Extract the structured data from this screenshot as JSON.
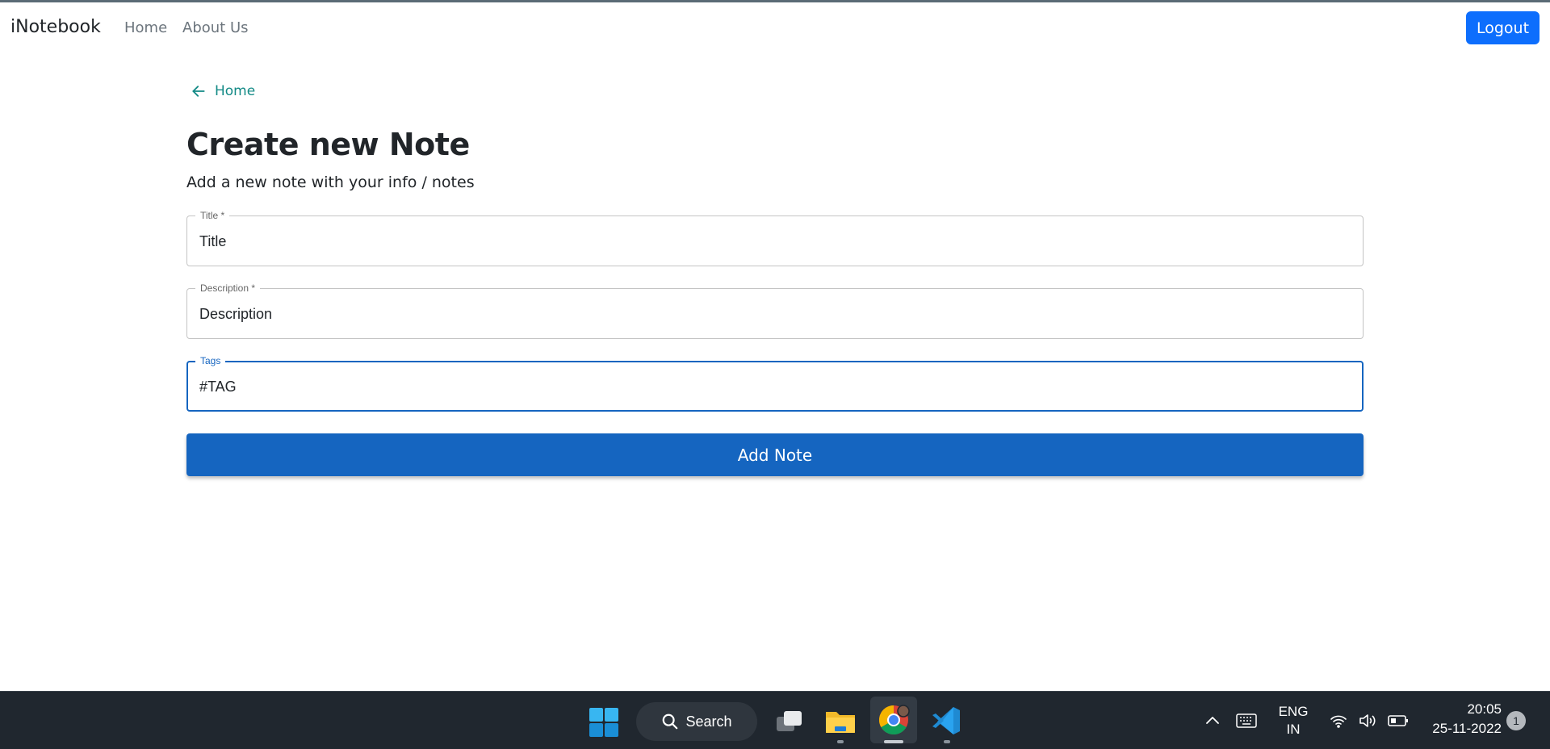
{
  "navbar": {
    "brand": "iNotebook",
    "links": [
      {
        "label": "Home"
      },
      {
        "label": "About Us"
      }
    ],
    "logout_label": "Logout"
  },
  "back_link": {
    "label": "Home",
    "icon": "arrow-left-icon"
  },
  "page": {
    "title": "Create new Note",
    "subtitle": "Add a new note with your info / notes"
  },
  "form": {
    "title_field": {
      "label": "Title *",
      "placeholder": "Title"
    },
    "description_field": {
      "label": "Description *",
      "placeholder": "Description"
    },
    "tags_field": {
      "label": "Tags",
      "placeholder": "#TAG"
    },
    "submit_label": "Add Note"
  },
  "taskbar": {
    "search_label": "Search",
    "lang_line1": "ENG",
    "lang_line2": "IN",
    "time": "20:05",
    "date": "25-11-2022",
    "notification_count": "1"
  },
  "colors": {
    "primary": "#0d6efd",
    "button": "#1565c0",
    "link": "#138a86",
    "taskbar": "#20272f"
  }
}
